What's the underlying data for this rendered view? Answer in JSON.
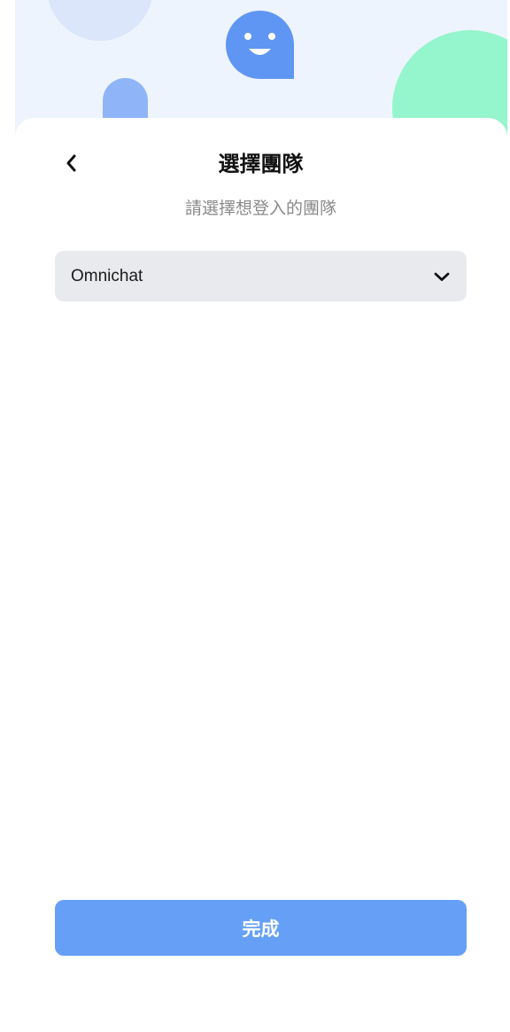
{
  "header": {
    "title": "選擇團隊",
    "subtitle": "請選擇想登入的團隊",
    "back_icon": "chevron-left-icon",
    "mascot_icon": "smiley-chat-bubble-icon"
  },
  "team_select": {
    "value": "Omnichat",
    "icon": "chevron-down-icon"
  },
  "footer": {
    "done_label": "完成"
  },
  "colors": {
    "accent": "#65a0f6",
    "mascot": "#6096f3",
    "header_bg": "#eef4fd",
    "blob_green": "#95f5cc",
    "blob_blue": "#8fb5f8",
    "select_bg": "#e9eaee"
  }
}
